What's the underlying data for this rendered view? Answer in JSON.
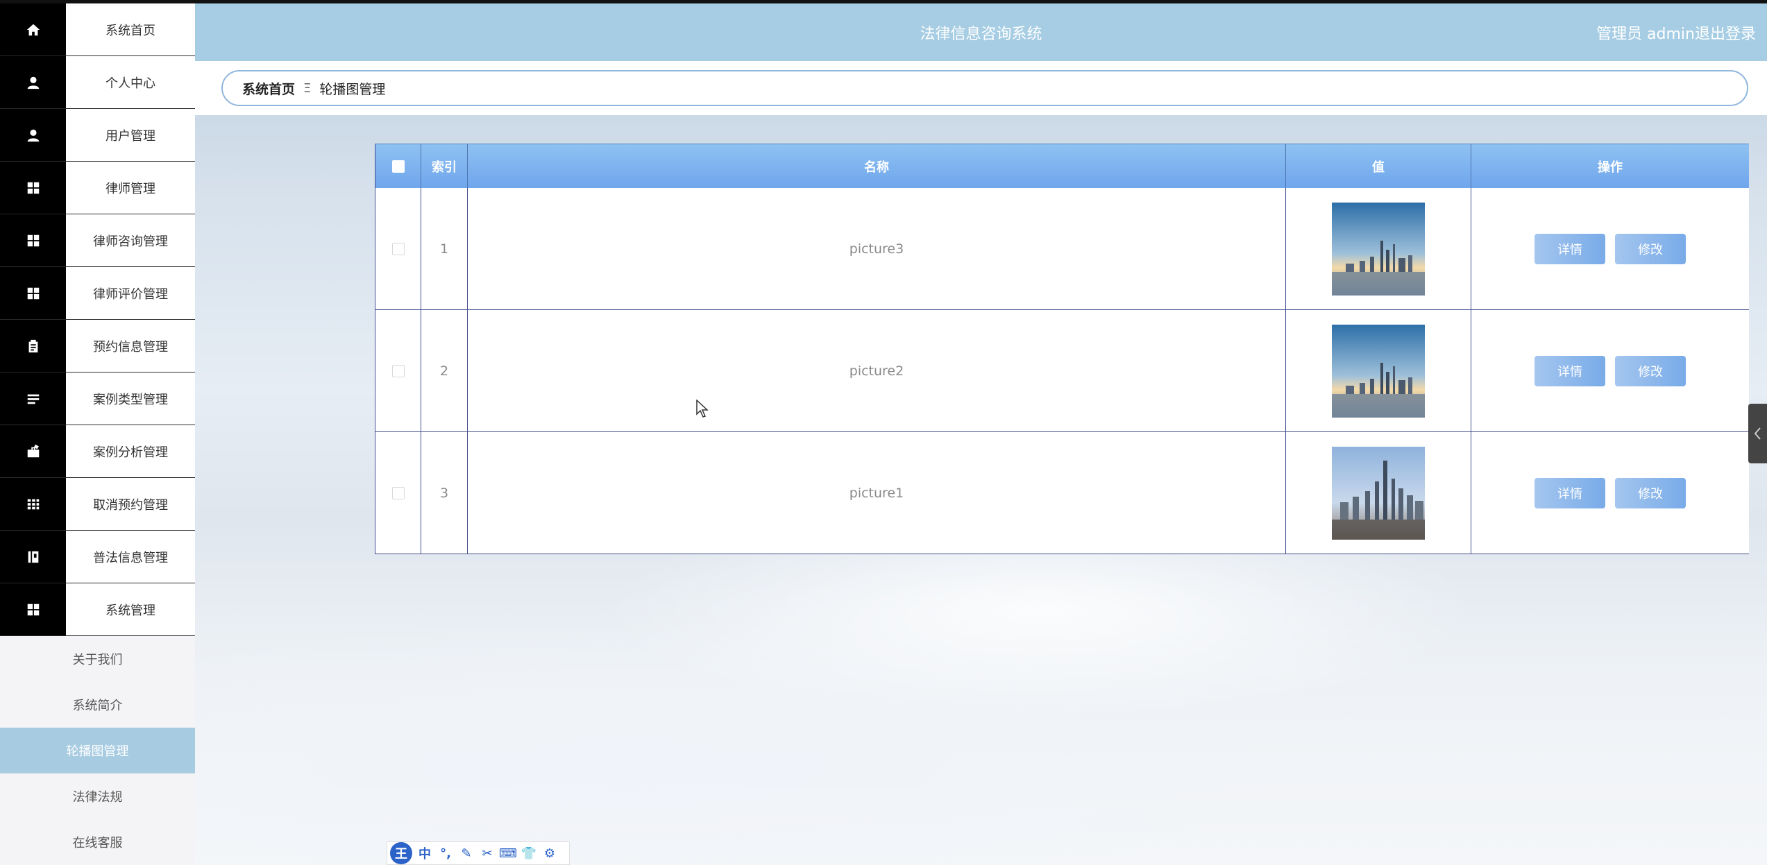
{
  "header": {
    "title": "法律信息咨询系统",
    "user": "管理员 admin",
    "logout": "退出登录"
  },
  "sidebar": {
    "items": [
      {
        "label": "系统首页",
        "icon": "home-icon"
      },
      {
        "label": "个人中心",
        "icon": "user-icon"
      },
      {
        "label": "用户管理",
        "icon": "user-icon"
      },
      {
        "label": "律师管理",
        "icon": "grid-icon"
      },
      {
        "label": "律师咨询管理",
        "icon": "grid-icon"
      },
      {
        "label": "律师评价管理",
        "icon": "grid-icon"
      },
      {
        "label": "预约信息管理",
        "icon": "clipboard-icon"
      },
      {
        "label": "案例类型管理",
        "icon": "list-icon"
      },
      {
        "label": "案例分析管理",
        "icon": "briefcase-icon"
      },
      {
        "label": "取消预约管理",
        "icon": "calendar-icon"
      },
      {
        "label": "普法信息管理",
        "icon": "book-icon"
      },
      {
        "label": "系统管理",
        "icon": "grid-icon"
      }
    ],
    "submenu": [
      {
        "label": "关于我们",
        "active": false
      },
      {
        "label": "系统简介",
        "active": false
      },
      {
        "label": "轮播图管理",
        "active": true
      },
      {
        "label": "法律法规",
        "active": false
      },
      {
        "label": "在线客服",
        "active": false
      }
    ]
  },
  "breadcrumb": {
    "home": "系统首页",
    "separator": "Ξ",
    "current": "轮播图管理"
  },
  "table": {
    "headers": {
      "index": "索引",
      "name": "名称",
      "value": "值",
      "ops": "操作"
    },
    "rows": [
      {
        "index": "1",
        "name": "picture3",
        "image": "city-sunrise"
      },
      {
        "index": "2",
        "name": "picture2",
        "image": "city-sunrise"
      },
      {
        "index": "3",
        "name": "picture1",
        "image": "city-skyscrapers"
      }
    ],
    "detail_label": "详情",
    "edit_label": "修改"
  },
  "ime": {
    "logo": "王",
    "mode": "中"
  },
  "colors": {
    "header_bg": "#a6cde3",
    "sidebar_icon_bg": "#000000",
    "submenu_active": "#a7cbe1",
    "table_header": "#7fb3ef",
    "button": "#8ab6ea"
  }
}
